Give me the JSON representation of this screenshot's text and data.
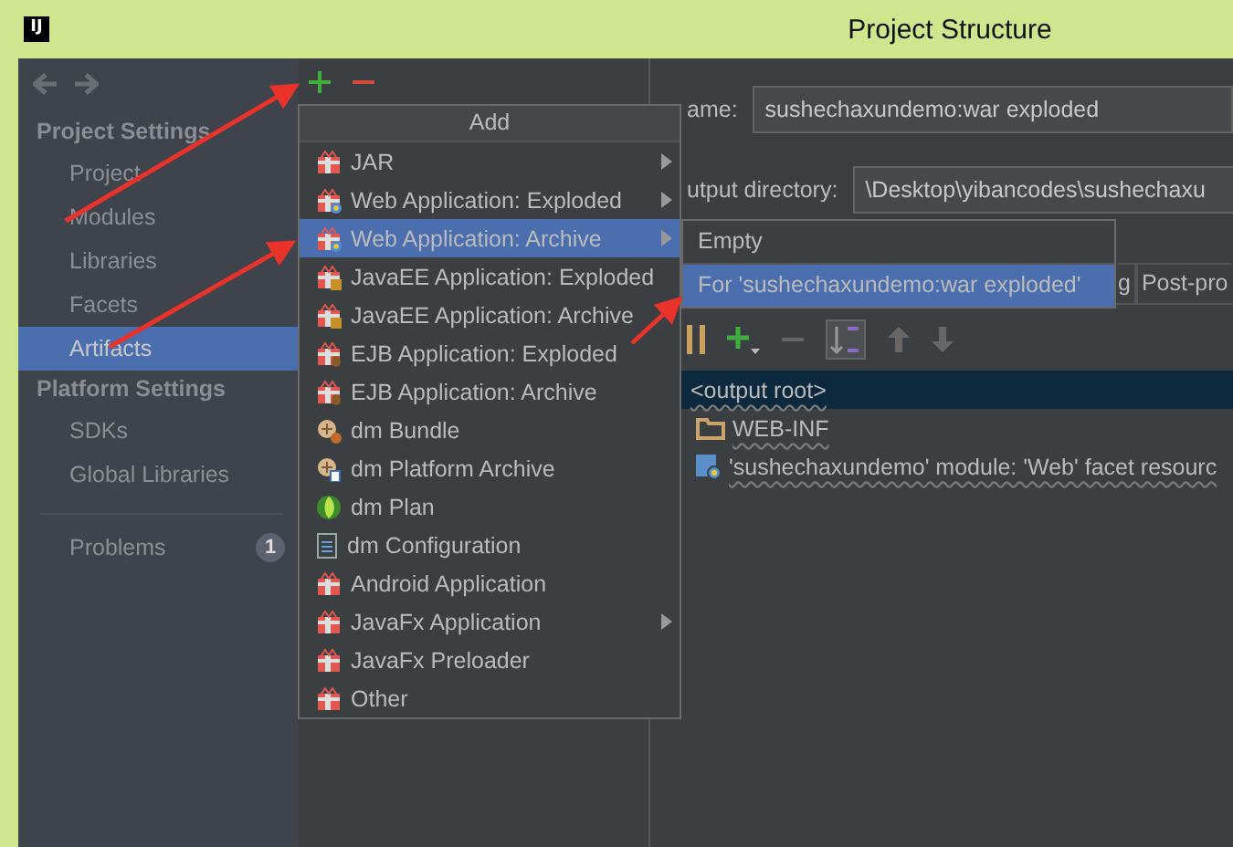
{
  "window": {
    "logo": "IJ",
    "title": "Project Structure"
  },
  "sidebar": {
    "sections": [
      {
        "title": "Project Settings",
        "items": [
          {
            "label": "Project",
            "selected": false
          },
          {
            "label": "Modules",
            "selected": false
          },
          {
            "label": "Libraries",
            "selected": false
          },
          {
            "label": "Facets",
            "selected": false
          },
          {
            "label": "Artifacts",
            "selected": true
          }
        ]
      },
      {
        "title": "Platform Settings",
        "items": [
          {
            "label": "SDKs",
            "selected": false
          },
          {
            "label": "Global Libraries",
            "selected": false
          }
        ]
      }
    ],
    "problems": {
      "label": "Problems",
      "count": "1"
    }
  },
  "add_menu": {
    "title": "Add",
    "items": [
      {
        "label": "JAR",
        "kind": "package",
        "submenu": true,
        "selected": false
      },
      {
        "label": "Web Application: Exploded",
        "kind": "web",
        "submenu": true,
        "selected": false
      },
      {
        "label": "Web Application: Archive",
        "kind": "web",
        "submenu": true,
        "selected": true
      },
      {
        "label": "JavaEE Application: Exploded",
        "kind": "javaee",
        "submenu": false,
        "selected": false
      },
      {
        "label": "JavaEE Application: Archive",
        "kind": "javaee",
        "submenu": false,
        "selected": false
      },
      {
        "label": "EJB Application: Exploded",
        "kind": "ejb",
        "submenu": false,
        "selected": false
      },
      {
        "label": "EJB Application: Archive",
        "kind": "ejb",
        "submenu": false,
        "selected": false
      },
      {
        "label": "dm Bundle",
        "kind": "bundle",
        "submenu": false,
        "selected": false
      },
      {
        "label": "dm Platform Archive",
        "kind": "platform",
        "submenu": false,
        "selected": false
      },
      {
        "label": "dm Plan",
        "kind": "plan",
        "submenu": false,
        "selected": false
      },
      {
        "label": "dm Configuration",
        "kind": "config",
        "submenu": false,
        "selected": false
      },
      {
        "label": "Android Application",
        "kind": "package",
        "submenu": false,
        "selected": false
      },
      {
        "label": "JavaFx Application",
        "kind": "package",
        "submenu": true,
        "selected": false
      },
      {
        "label": "JavaFx Preloader",
        "kind": "package",
        "submenu": false,
        "selected": false
      },
      {
        "label": "Other",
        "kind": "package",
        "submenu": false,
        "selected": false
      }
    ]
  },
  "submenu": {
    "items": [
      {
        "label": "Empty",
        "selected": false
      },
      {
        "label": "For 'sushechaxundemo:war exploded'",
        "selected": true
      }
    ]
  },
  "detail": {
    "name_label": "ame:",
    "name_value": "sushechaxundemo:war exploded",
    "output_label": "utput directory:",
    "output_value": "\\Desktop\\yibancodes\\sushechaxu",
    "tabs": [
      {
        "label": "g",
        "selected": false
      },
      {
        "label": "Post-pro",
        "selected": false
      }
    ],
    "tree": [
      {
        "label": "<output root>",
        "selected": true,
        "children": [
          {
            "label": "WEB-INF",
            "kind": "folder",
            "selected": false
          },
          {
            "label": "'sushechaxundemo' module: 'Web' facet resourc",
            "kind": "module",
            "selected": false
          }
        ]
      }
    ]
  }
}
